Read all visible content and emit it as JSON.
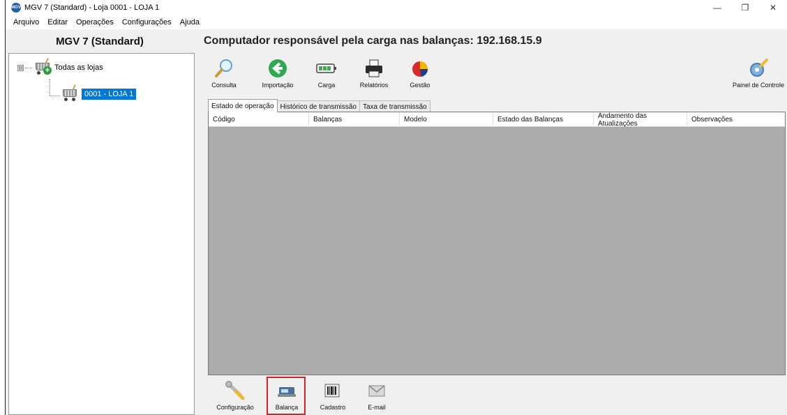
{
  "window": {
    "title": "MGV 7 (Standard) - Loja 0001 - LOJA 1",
    "logo_text": "MGV",
    "controls": {
      "minimize": "—",
      "restore": "❐",
      "close": "✕"
    }
  },
  "menu": [
    "Arquivo",
    "Editar",
    "Operações",
    "Configurações",
    "Ajuda"
  ],
  "left_panel": {
    "title": "MGV 7 (Standard)",
    "tree": {
      "root_label": "Todas as lojas",
      "expander": "⊟",
      "child_label": "0001 - LOJA 1"
    }
  },
  "main": {
    "header": "Computador responsável pela carga nas balanças: 192.168.15.9",
    "toolbar": {
      "consulta": "Consulta",
      "importacao": "Importação",
      "carga": "Carga",
      "relatorios": "Relatórios",
      "gestao": "Gestão",
      "painel": "Painel de Controle"
    },
    "tabs": [
      "Estado de operação",
      "Histórico de transmissão",
      "Taxa de transmissão"
    ],
    "columns": [
      "Código",
      "Balanças",
      "Modelo",
      "Estado das Balanças",
      "Andamento das Atualizações",
      "Observações"
    ],
    "bottom_toolbar": {
      "configuracao": "Configuração",
      "balanca": "Balança",
      "cadastro": "Cadastro",
      "email": "E-mail"
    }
  },
  "colors": {
    "selection": "#0078d7",
    "grid_background": "#ababab",
    "highlight_border": "#d0242b"
  }
}
